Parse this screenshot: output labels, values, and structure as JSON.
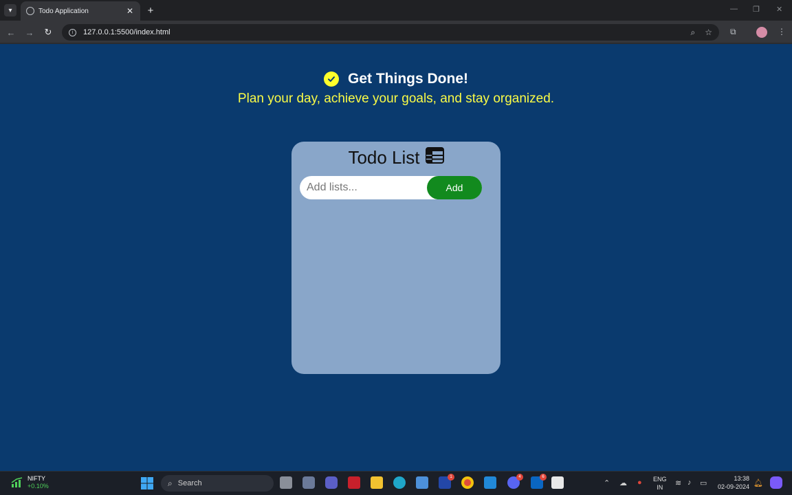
{
  "browser": {
    "tab_title": "Todo Application",
    "tab_close": "✕",
    "new_tab": "+",
    "url": "127.0.0.1:5500/index.html"
  },
  "page": {
    "heading": "Get Things Done!",
    "subheading": "Plan your day, achieve your goals, and stay organized.",
    "card_title": "Todo List",
    "input_placeholder": "Add lists...",
    "add_label": "Add"
  },
  "taskbar": {
    "ticker_name": "NIFTY",
    "ticker_change": "+0.10%",
    "search_label": "Search",
    "lang_1": "ENG",
    "lang_2": "IN",
    "time": "13:38",
    "date": "02-09-2024",
    "badges": {
      "office": "1",
      "discord": "4",
      "linkedin": "6"
    }
  },
  "colors": {
    "page_bg": "#0a3a6e",
    "card_bg": "#89a6c9",
    "add_button": "#128a1e",
    "accent_yellow": "#fafb46"
  }
}
